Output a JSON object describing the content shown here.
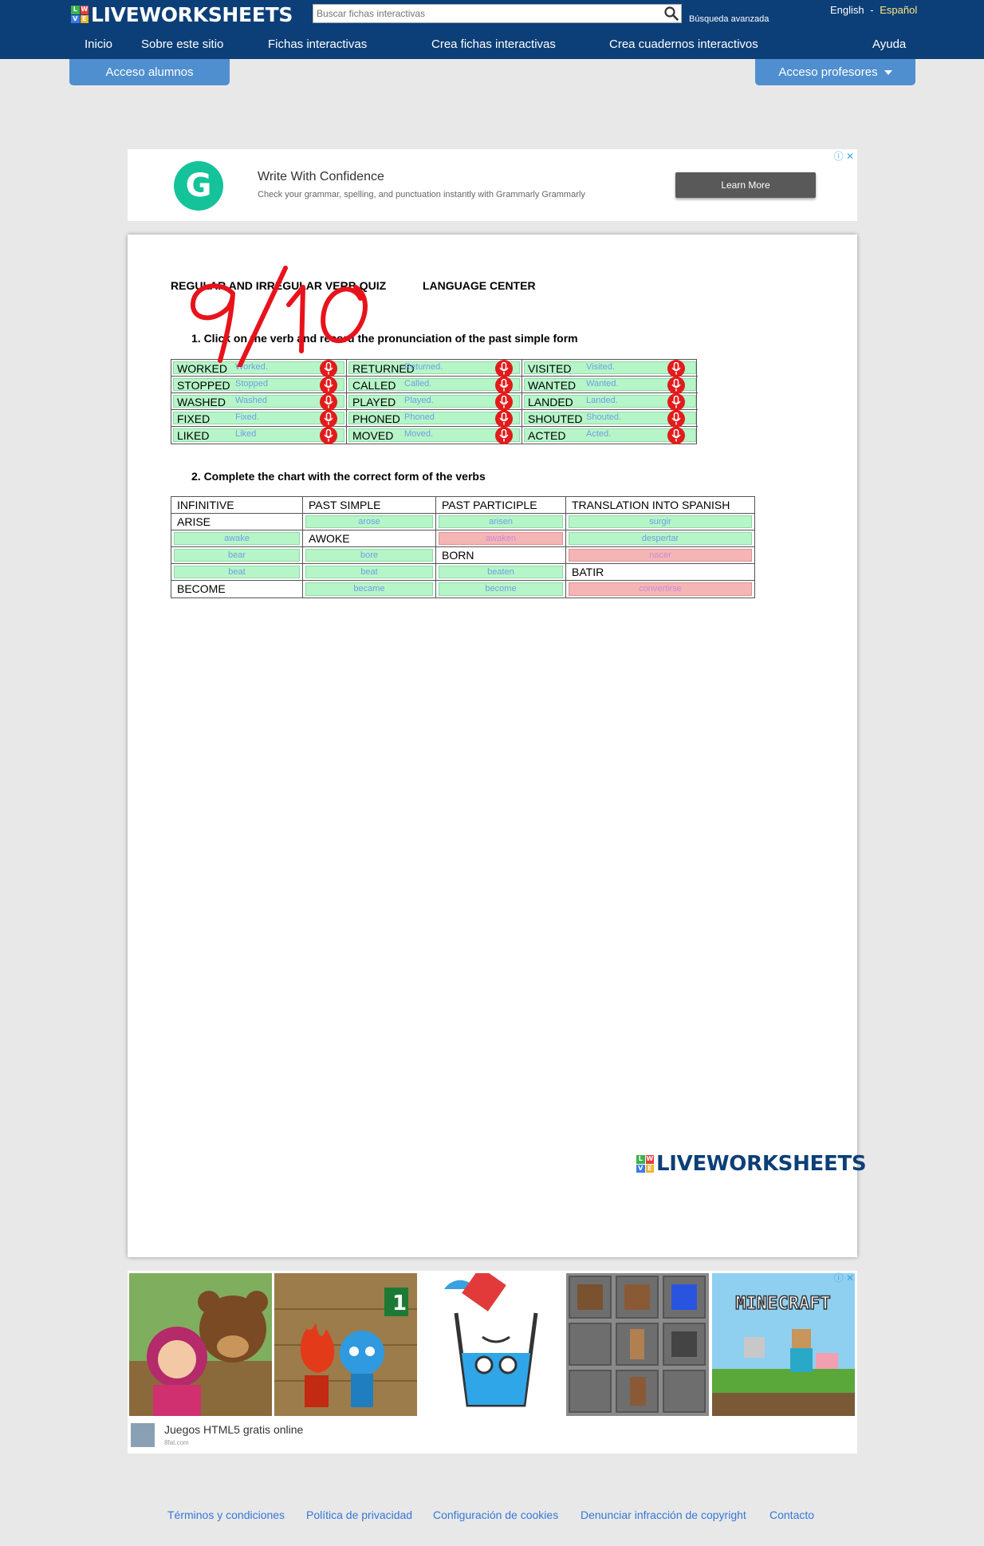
{
  "header": {
    "logo": "LIVEWORKSHEETS",
    "logo_cubes": [
      "L",
      "W",
      "V",
      "E"
    ],
    "search_placeholder": "Buscar fichas interactivas",
    "advanced_search": "Búsqueda avanzada",
    "lang_en": "English",
    "lang_sep": "-",
    "lang_es": "Español",
    "nav": [
      "Inicio",
      "Sobre este sitio",
      "Fichas interactivas",
      "Crea fichas interactivas",
      "Crea cuadernos interactivos",
      "Ayuda"
    ],
    "students": "Acceso alumnos",
    "teachers": "Acceso profesores"
  },
  "ad_banner": {
    "logo_letter": "G",
    "title": "Write With Confidence",
    "subtitle": "Check your grammar, spelling, and punctuation instantly with Grammarly Grammarly",
    "button": "Learn More",
    "adchoices": "ⓘ ✕"
  },
  "worksheet": {
    "title": "REGULAR AND IRREGULAR VERB QUIZ",
    "center": "LANGUAGE CENTER",
    "score": "9/10",
    "q1": "1.  Click on the verb and record the pronunciation of the past simple form",
    "q2": "2.  Complete the chart with the correct form of the verbs",
    "pron_rows": [
      [
        {
          "verb": "WORKED",
          "ans": "Worked."
        },
        {
          "verb": "RETURNED",
          "ans": "Returned."
        },
        {
          "verb": "VISITED",
          "ans": "Visited."
        }
      ],
      [
        {
          "verb": "STOPPED",
          "ans": "Stopped"
        },
        {
          "verb": "CALLED",
          "ans": "Called."
        },
        {
          "verb": "WANTED",
          "ans": "Wanted."
        }
      ],
      [
        {
          "verb": "WASHED",
          "ans": "Washed"
        },
        {
          "verb": "PLAYED",
          "ans": "Played."
        },
        {
          "verb": "LANDED",
          "ans": "Landed."
        }
      ],
      [
        {
          "verb": "FIXED",
          "ans": "Fixed."
        },
        {
          "verb": "PHONED",
          "ans": "Phoned"
        },
        {
          "verb": "SHOUTED",
          "ans": "Shouted."
        }
      ],
      [
        {
          "verb": "LIKED",
          "ans": "Liked"
        },
        {
          "verb": "MOVED",
          "ans": "Moved."
        },
        {
          "verb": "ACTED",
          "ans": "Acted."
        }
      ]
    ],
    "chart_headers": [
      "INFINITIVE",
      "PAST SIMPLE",
      "PAST PARTICIPLE",
      "TRANSLATION INTO SPANISH"
    ],
    "chart_rows": [
      [
        {
          "text": "ARISE"
        },
        {
          "input": "arose"
        },
        {
          "input": "arisen"
        },
        {
          "input": "surgir"
        }
      ],
      [
        {
          "input": "awake"
        },
        {
          "text": "AWOKE"
        },
        {
          "input": "awaken",
          "wrong": true
        },
        {
          "input": "despertar"
        }
      ],
      [
        {
          "input": "bear"
        },
        {
          "input": "bore"
        },
        {
          "text": "BORN"
        },
        {
          "input": "nacer",
          "wrong": true
        }
      ],
      [
        {
          "input": "beat"
        },
        {
          "input": "beat"
        },
        {
          "input": "beaten"
        },
        {
          "text": "BATIR"
        }
      ],
      [
        {
          "text": "BECOME"
        },
        {
          "input": "became"
        },
        {
          "input": "become"
        },
        {
          "input": "convertirse",
          "wrong": true
        }
      ]
    ],
    "footer_logo": "LIVEWORKSHEETS"
  },
  "games_ad": {
    "title": "Juegos HTML5 gratis online",
    "site": "8fat.com",
    "adchoices": "ⓘ ✕",
    "tile_text_minecraft": "MINECRAFT",
    "tile_number": "1"
  },
  "footer": [
    "Términos y condiciones",
    "Política de privacidad",
    "Configuración de cookies",
    "Denunciar infracción de copyright",
    "Contacto"
  ]
}
